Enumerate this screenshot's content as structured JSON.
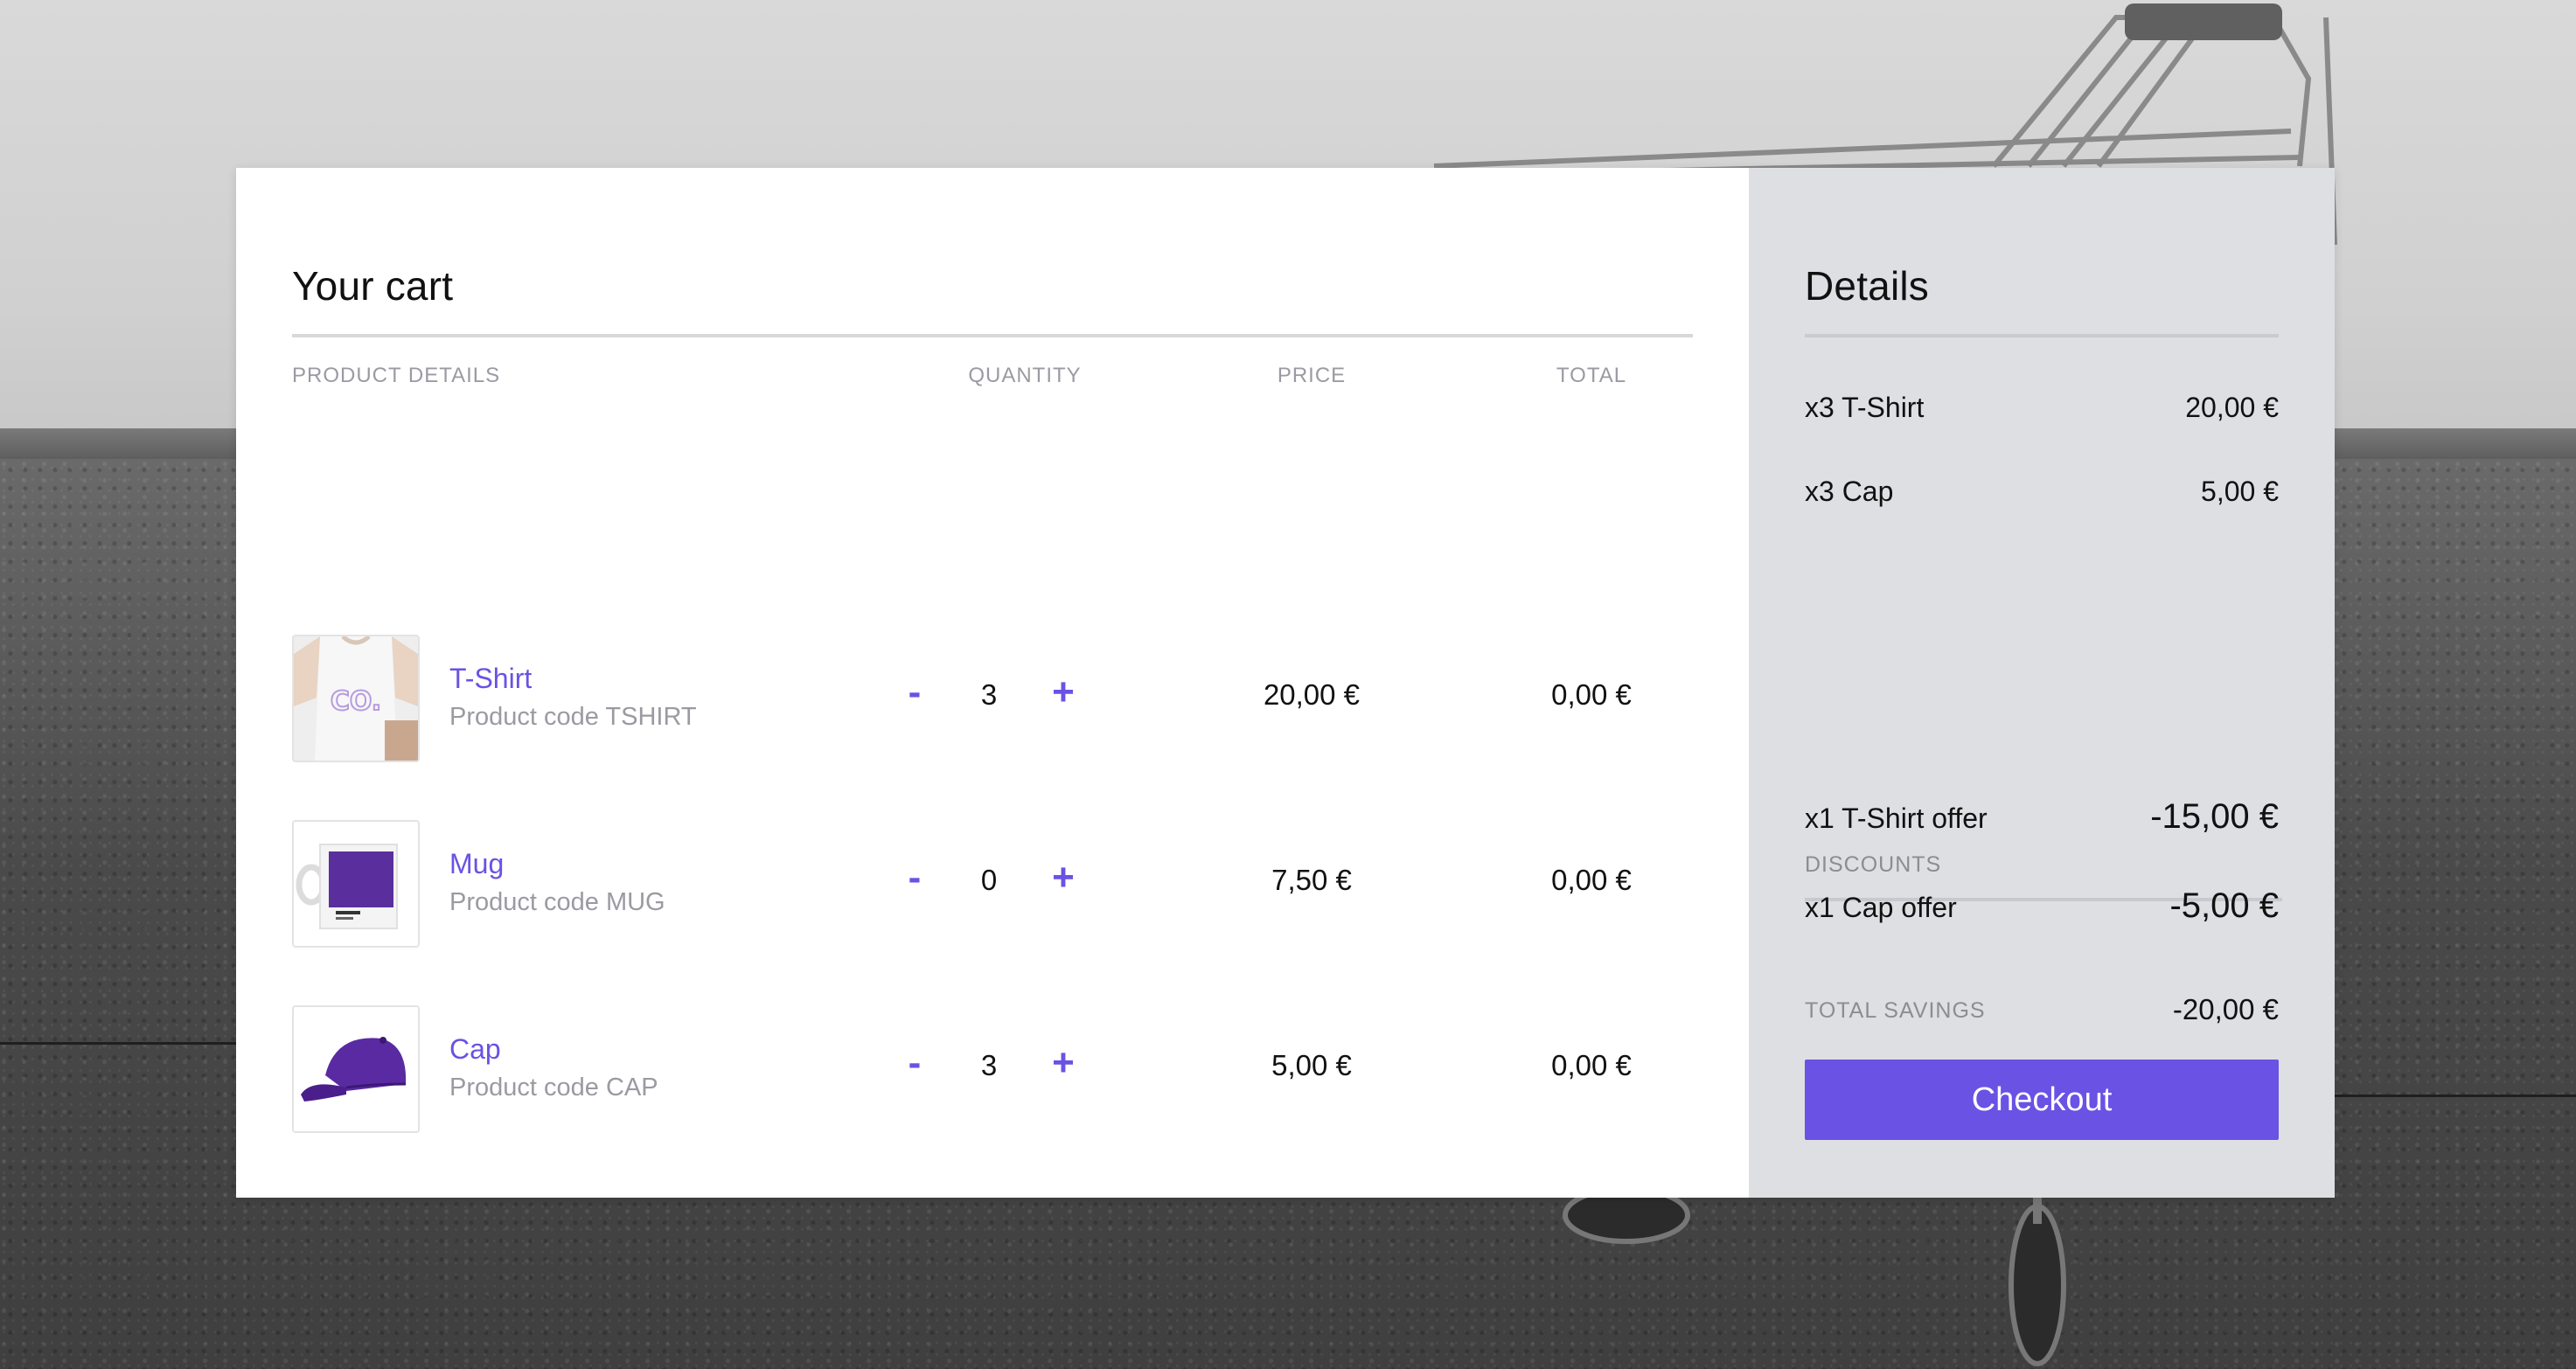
{
  "cart": {
    "title": "Your cart",
    "columns": {
      "product": "PRODUCT DETAILS",
      "quantity": "QUANTITY",
      "price": "PRICE",
      "total": "TOTAL"
    },
    "items": [
      {
        "name": "T-Shirt",
        "code": "Product code TSHIRT",
        "minus": "-",
        "quantity": "3",
        "plus": "+",
        "price": "20,00 €",
        "total": "0,00 €",
        "image": "tshirt-image"
      },
      {
        "name": "Mug",
        "code": "Product code MUG",
        "minus": "-",
        "quantity": "0",
        "plus": "+",
        "price": "7,50 €",
        "total": "0,00 €",
        "image": "mug-image"
      },
      {
        "name": "Cap",
        "code": "Product code CAP",
        "minus": "-",
        "quantity": "3",
        "plus": "+",
        "price": "5,00 €",
        "total": "0,00 €",
        "image": "cap-image"
      }
    ]
  },
  "details": {
    "title": "Details",
    "lines": [
      {
        "label": "x3 T-Shirt",
        "amount": "20,00 €"
      },
      {
        "label": "x3 Cap",
        "amount": "5,00 €"
      }
    ],
    "discounts_header": "DISCOUNTS",
    "discounts": [
      {
        "label": "x1 T-Shirt offer",
        "amount": "-15,00 €"
      },
      {
        "label": "x1 Cap offer",
        "amount": "-5,00 €"
      }
    ],
    "total_savings_label": "TOTAL SAVINGS",
    "total_savings_amount": "-20,00 €",
    "checkout_label": "Checkout"
  },
  "colors": {
    "accent": "#6a52e4",
    "card_bg": "#ffffff",
    "details_bg": "#dedfe3",
    "muted_text": "#9a9aa2"
  }
}
